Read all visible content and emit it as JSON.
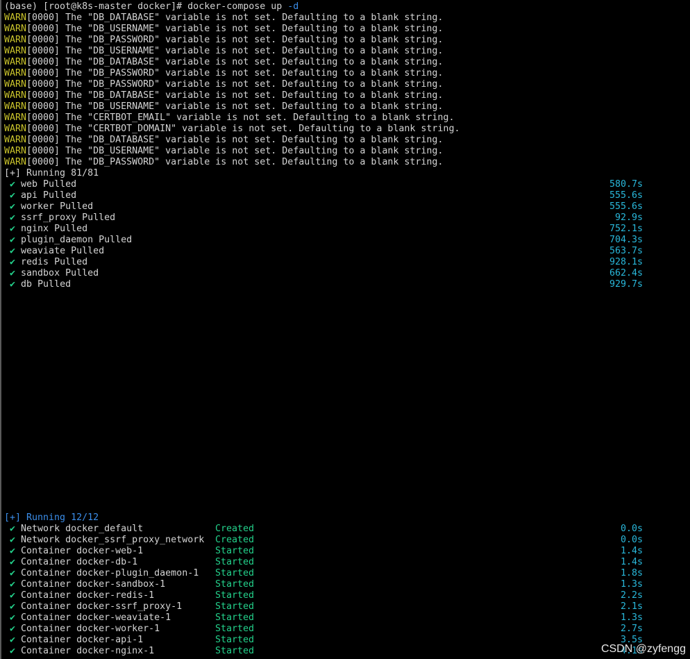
{
  "prompt": {
    "prefix": "(base) [root@k8s-master docker]# docker-compose up ",
    "flag": "-d"
  },
  "warnings": [
    {
      "tag": "WARN",
      "rest": "[0000] The \"DB_DATABASE\" variable is not set. Defaulting to a blank string."
    },
    {
      "tag": "WARN",
      "rest": "[0000] The \"DB_USERNAME\" variable is not set. Defaulting to a blank string."
    },
    {
      "tag": "WARN",
      "rest": "[0000] The \"DB_PASSWORD\" variable is not set. Defaulting to a blank string."
    },
    {
      "tag": "WARN",
      "rest": "[0000] The \"DB_USERNAME\" variable is not set. Defaulting to a blank string."
    },
    {
      "tag": "WARN",
      "rest": "[0000] The \"DB_DATABASE\" variable is not set. Defaulting to a blank string."
    },
    {
      "tag": "WARN",
      "rest": "[0000] The \"DB_PASSWORD\" variable is not set. Defaulting to a blank string."
    },
    {
      "tag": "WARN",
      "rest": "[0000] The \"DB_PASSWORD\" variable is not set. Defaulting to a blank string."
    },
    {
      "tag": "WARN",
      "rest": "[0000] The \"DB_DATABASE\" variable is not set. Defaulting to a blank string."
    },
    {
      "tag": "WARN",
      "rest": "[0000] The \"DB_USERNAME\" variable is not set. Defaulting to a blank string."
    },
    {
      "tag": "WARN",
      "rest": "[0000] The \"CERTBOT_EMAIL\" variable is not set. Defaulting to a blank string."
    },
    {
      "tag": "WARN",
      "rest": "[0000] The \"CERTBOT_DOMAIN\" variable is not set. Defaulting to a blank string."
    },
    {
      "tag": "WARN",
      "rest": "[0000] The \"DB_DATABASE\" variable is not set. Defaulting to a blank string."
    },
    {
      "tag": "WARN",
      "rest": "[0000] The \"DB_USERNAME\" variable is not set. Defaulting to a blank string."
    },
    {
      "tag": "WARN",
      "rest": "[0000] The \"DB_PASSWORD\" variable is not set. Defaulting to a blank string."
    }
  ],
  "pull_section": {
    "header": "[+] Running 81/81",
    "items": [
      {
        "check": "✔",
        "label": "web Pulled",
        "time": "580.7s"
      },
      {
        "check": "✔",
        "label": "api Pulled",
        "time": "555.6s"
      },
      {
        "check": "✔",
        "label": "worker Pulled",
        "time": "555.6s"
      },
      {
        "check": "✔",
        "label": "ssrf_proxy Pulled",
        "time": "92.9s"
      },
      {
        "check": "✔",
        "label": "nginx Pulled",
        "time": "752.1s"
      },
      {
        "check": "✔",
        "label": "plugin_daemon Pulled",
        "time": "704.3s"
      },
      {
        "check": "✔",
        "label": "weaviate Pulled",
        "time": "563.7s"
      },
      {
        "check": "✔",
        "label": "redis Pulled",
        "time": "928.1s"
      },
      {
        "check": "✔",
        "label": "sandbox Pulled",
        "time": "662.4s"
      },
      {
        "check": "✔",
        "label": "db Pulled",
        "time": "929.7s"
      }
    ]
  },
  "run_section": {
    "header": "[+] Running 12/12",
    "items": [
      {
        "check": "✔",
        "label": "Network docker_default",
        "status": "Created",
        "time": "0.0s"
      },
      {
        "check": "✔",
        "label": "Network docker_ssrf_proxy_network",
        "status": "Created",
        "time": "0.0s"
      },
      {
        "check": "✔",
        "label": "Container docker-web-1",
        "status": "Started",
        "time": "1.4s"
      },
      {
        "check": "✔",
        "label": "Container docker-db-1",
        "status": "Started",
        "time": "1.4s"
      },
      {
        "check": "✔",
        "label": "Container docker-plugin_daemon-1",
        "status": "Started",
        "time": "1.8s"
      },
      {
        "check": "✔",
        "label": "Container docker-sandbox-1",
        "status": "Started",
        "time": "1.3s"
      },
      {
        "check": "✔",
        "label": "Container docker-redis-1",
        "status": "Started",
        "time": "2.2s"
      },
      {
        "check": "✔",
        "label": "Container docker-ssrf_proxy-1",
        "status": "Started",
        "time": "2.1s"
      },
      {
        "check": "✔",
        "label": "Container docker-weaviate-1",
        "status": "Started",
        "time": "1.3s"
      },
      {
        "check": "✔",
        "label": "Container docker-worker-1",
        "status": "Started",
        "time": "2.7s"
      },
      {
        "check": "✔",
        "label": "Container docker-api-1",
        "status": "Started",
        "time": "3.5s"
      },
      {
        "check": "✔",
        "label": "Container docker-nginx-1",
        "status": "Started",
        "time": "4.1s"
      }
    ]
  },
  "watermark": "CSDN @zyfengg"
}
